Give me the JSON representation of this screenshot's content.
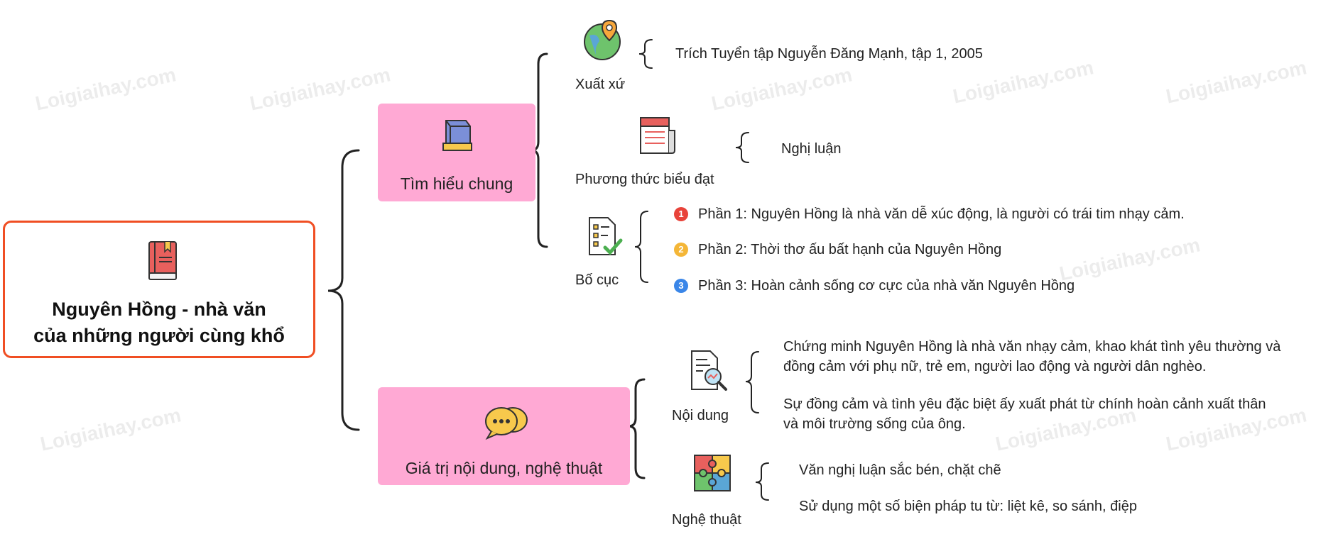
{
  "root": {
    "title_line1": "Nguyên Hồng - nhà văn",
    "title_line2": "của những người cùng khổ"
  },
  "branches": [
    {
      "label": "Tìm hiểu chung",
      "children": [
        {
          "label": "Xuất xứ",
          "icon": "globe-pin-icon",
          "details": [
            "Trích Tuyển tập Nguyễn Đăng Mạnh, tập 1, 2005"
          ]
        },
        {
          "label": "Phương thức biểu đạt",
          "icon": "newspaper-icon",
          "details": [
            "Nghị luận"
          ]
        },
        {
          "label": "Bố cục",
          "icon": "checklist-icon",
          "details": [
            {
              "num": "1",
              "color": "#e8433a",
              "text": "Phần 1: Nguyên Hồng là nhà văn dễ xúc động, là người có trái tim nhạy cảm."
            },
            {
              "num": "2",
              "color": "#f4b637",
              "text": "Phần 2: Thời thơ ấu bất hạnh của Nguyên Hồng"
            },
            {
              "num": "3",
              "color": "#3a86e8",
              "text": "Phần 3: Hoàn cảnh sống cơ cực của nhà văn Nguyên Hồng"
            }
          ]
        }
      ]
    },
    {
      "label": "Giá trị nội dung, nghệ thuật",
      "children": [
        {
          "label": "Nội dung",
          "icon": "document-search-icon",
          "details": [
            "Chứng minh Nguyên Hồng là nhà văn nhạy cảm, khao khát tình yêu thường và",
            "đồng cảm với phụ nữ, trẻ em, người lao động và người dân nghèo.",
            "Sự đồng cảm và tình yêu đặc biệt ấy xuất phát từ chính hoàn cảnh xuất thân",
            "và môi trường sống của ông."
          ]
        },
        {
          "label": "Nghệ thuật",
          "icon": "puzzle-icon",
          "details": [
            "Văn nghị luận sắc bén, chặt chẽ",
            "Sử dụng một số biện pháp tu từ: liệt kê, so sánh, điệp"
          ]
        }
      ]
    }
  ],
  "watermark": "Loigiaihay.com",
  "colors": {
    "root_border": "#f04e23",
    "branch_fill": "#ffa9d4",
    "line": "#222222"
  }
}
